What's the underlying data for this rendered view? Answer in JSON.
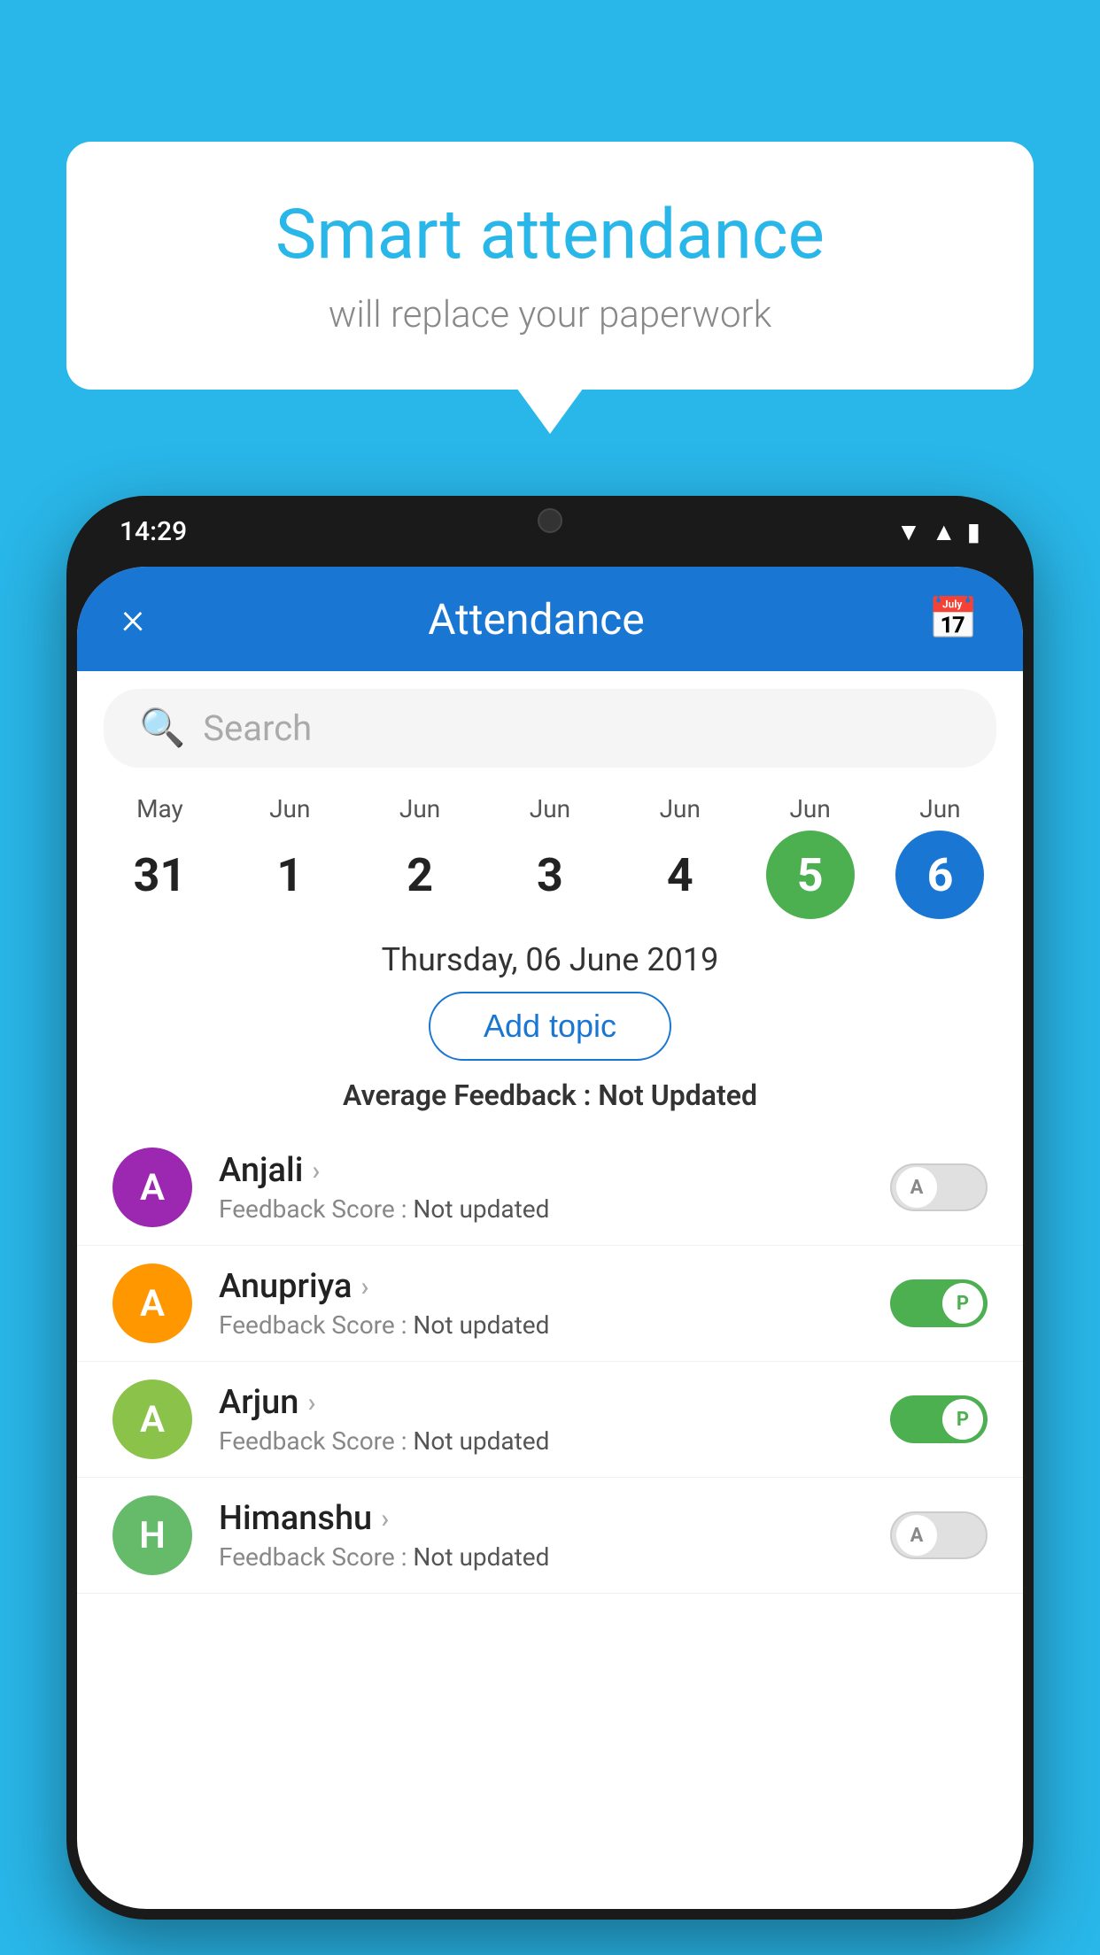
{
  "background_color": "#29B6E8",
  "speech_bubble": {
    "title": "Smart attendance",
    "subtitle": "will replace your paperwork"
  },
  "phone": {
    "status_bar": {
      "time": "14:29"
    },
    "app_bar": {
      "title": "Attendance",
      "close_label": "×",
      "calendar_icon": "📅"
    },
    "search": {
      "placeholder": "Search"
    },
    "calendar": {
      "days": [
        {
          "month": "May",
          "date": "31",
          "state": "normal"
        },
        {
          "month": "Jun",
          "date": "1",
          "state": "normal"
        },
        {
          "month": "Jun",
          "date": "2",
          "state": "normal"
        },
        {
          "month": "Jun",
          "date": "3",
          "state": "normal"
        },
        {
          "month": "Jun",
          "date": "4",
          "state": "normal"
        },
        {
          "month": "Jun",
          "date": "5",
          "state": "today"
        },
        {
          "month": "Jun",
          "date": "6",
          "state": "selected"
        }
      ]
    },
    "selected_date": "Thursday, 06 June 2019",
    "add_topic_label": "Add topic",
    "avg_feedback_label": "Average Feedback :",
    "avg_feedback_value": "Not Updated",
    "students": [
      {
        "name": "Anjali",
        "avatar_letter": "A",
        "avatar_color": "purple",
        "feedback": "Not updated",
        "toggle": "off",
        "toggle_letter": "A"
      },
      {
        "name": "Anupriya",
        "avatar_letter": "A",
        "avatar_color": "orange",
        "feedback": "Not updated",
        "toggle": "on",
        "toggle_letter": "P"
      },
      {
        "name": "Arjun",
        "avatar_letter": "A",
        "avatar_color": "green",
        "feedback": "Not updated",
        "toggle": "on",
        "toggle_letter": "P"
      },
      {
        "name": "Himanshu",
        "avatar_letter": "H",
        "avatar_color": "green2",
        "feedback": "Not updated",
        "toggle": "off",
        "toggle_letter": "A"
      }
    ],
    "feedback_score_label": "Feedback Score :"
  }
}
